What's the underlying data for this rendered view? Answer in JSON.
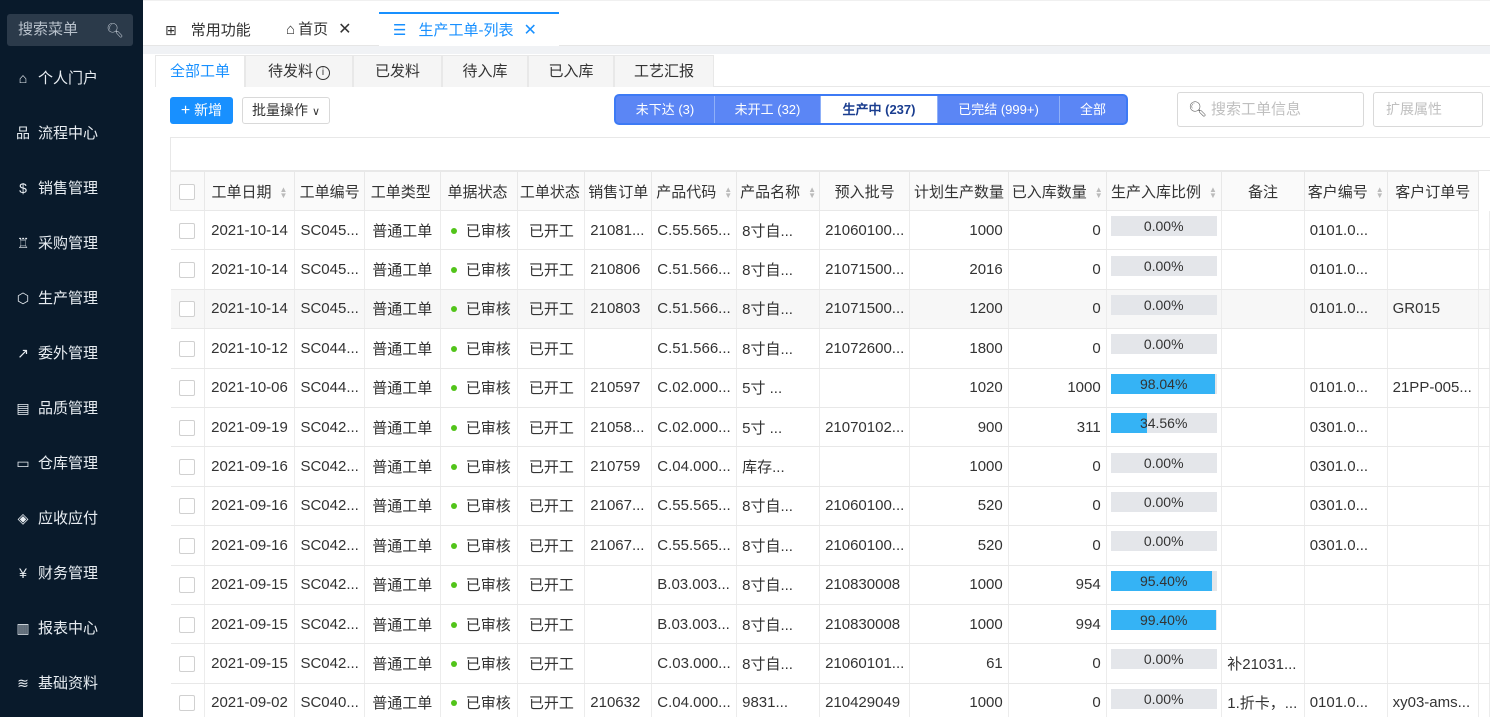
{
  "sidebar": {
    "search_placeholder": "搜索菜单",
    "items": [
      {
        "label": "个人门户",
        "icon": "home-icon",
        "glyph": "⌂"
      },
      {
        "label": "流程中心",
        "icon": "flow-icon",
        "glyph": "品"
      },
      {
        "label": "销售管理",
        "icon": "dollar-icon",
        "glyph": "$"
      },
      {
        "label": "采购管理",
        "icon": "cart-icon",
        "glyph": "♖"
      },
      {
        "label": "生产管理",
        "icon": "box-icon",
        "glyph": "⬡"
      },
      {
        "label": "委外管理",
        "icon": "external-link-icon",
        "glyph": "↗"
      },
      {
        "label": "品质管理",
        "icon": "quality-doc-icon",
        "glyph": "▤"
      },
      {
        "label": "仓库管理",
        "icon": "inbox-icon",
        "glyph": "▭"
      },
      {
        "label": "应收应付",
        "icon": "shield-icon",
        "glyph": "◈"
      },
      {
        "label": "财务管理",
        "icon": "yen-icon",
        "glyph": "¥"
      },
      {
        "label": "报表中心",
        "icon": "bar-chart-icon",
        "glyph": "▥"
      },
      {
        "label": "基础资料",
        "icon": "layers-icon",
        "glyph": "≋"
      }
    ]
  },
  "tabs": {
    "common": "常用功能",
    "home": "首页",
    "current": "生产工单-列表"
  },
  "subtabs": [
    "全部工单",
    "待发料",
    "已发料",
    "待入库",
    "已入库",
    "工艺汇报"
  ],
  "toolbar": {
    "add": "新增",
    "batch": "批量操作"
  },
  "segments": [
    "未下达 (3)",
    "未开工 (32)",
    "生产中 (237)",
    "已完结 (999+)",
    "全部"
  ],
  "search": {
    "placeholder": "搜索工单信息"
  },
  "ext_attr": "扩展属性",
  "table": {
    "columns": [
      "工单日期",
      "工单编号",
      "工单类型",
      "单据状态",
      "工单状态",
      "销售订单",
      "产品代码",
      "产品名称",
      "预入批号",
      "计划生产数量",
      "已入库数量",
      "生产入库比例",
      "备注",
      "客户编号",
      "客户订单号"
    ],
    "rows": [
      {
        "date": "2021-10-14",
        "no": "SC045...",
        "type": "普通工单",
        "doc": "已审核",
        "status": "已开工",
        "so": "21081...",
        "code": "C.55.565...",
        "name": "8寸自...",
        "batch": "21060100...",
        "plan": "1000",
        "in": "0",
        "ratio": 0.0,
        "ratio_text": "0.00%",
        "note": "",
        "cust": "0101.0...",
        "cust_order": ""
      },
      {
        "date": "2021-10-14",
        "no": "SC045...",
        "type": "普通工单",
        "doc": "已审核",
        "status": "已开工",
        "so": "210806",
        "code": "C.51.566...",
        "name": "8寸自...",
        "batch": "21071500...",
        "plan": "2016",
        "in": "0",
        "ratio": 0.0,
        "ratio_text": "0.00%",
        "note": "",
        "cust": "0101.0...",
        "cust_order": ""
      },
      {
        "date": "2021-10-14",
        "no": "SC045...",
        "type": "普通工单",
        "doc": "已审核",
        "status": "已开工",
        "so": "210803",
        "code": "C.51.566...",
        "name": "8寸自...",
        "batch": "21071500...",
        "plan": "1200",
        "in": "0",
        "ratio": 0.0,
        "ratio_text": "0.00%",
        "note": "",
        "cust": "0101.0...",
        "cust_order": "GR015"
      },
      {
        "date": "2021-10-12",
        "no": "SC044...",
        "type": "普通工单",
        "doc": "已审核",
        "status": "已开工",
        "so": "",
        "code": "C.51.566...",
        "name": "8寸自...",
        "batch": "21072600...",
        "plan": "1800",
        "in": "0",
        "ratio": 0.0,
        "ratio_text": "0.00%",
        "note": "",
        "cust": "",
        "cust_order": ""
      },
      {
        "date": "2021-10-06",
        "no": "SC044...",
        "type": "普通工单",
        "doc": "已审核",
        "status": "已开工",
        "so": "210597",
        "code": "C.02.000...",
        "name": "5寸 ...",
        "batch": "",
        "plan": "1020",
        "in": "1000",
        "ratio": 98.04,
        "ratio_text": "98.04%",
        "note": "",
        "cust": "0101.0...",
        "cust_order": "21PP-005..."
      },
      {
        "date": "2021-09-19",
        "no": "SC042...",
        "type": "普通工单",
        "doc": "已审核",
        "status": "已开工",
        "so": "21058...",
        "code": "C.02.000...",
        "name": "5寸 ...",
        "batch": "21070102...",
        "plan": "900",
        "in": "311",
        "ratio": 34.56,
        "ratio_text": "34.56%",
        "note": "",
        "cust": "0301.0...",
        "cust_order": ""
      },
      {
        "date": "2021-09-16",
        "no": "SC042...",
        "type": "普通工单",
        "doc": "已审核",
        "status": "已开工",
        "so": "210759",
        "code": "C.04.000...",
        "name": "库存...",
        "batch": "",
        "plan": "1000",
        "in": "0",
        "ratio": 0.0,
        "ratio_text": "0.00%",
        "note": "",
        "cust": "0301.0...",
        "cust_order": ""
      },
      {
        "date": "2021-09-16",
        "no": "SC042...",
        "type": "普通工单",
        "doc": "已审核",
        "status": "已开工",
        "so": "21067...",
        "code": "C.55.565...",
        "name": "8寸自...",
        "batch": "21060100...",
        "plan": "520",
        "in": "0",
        "ratio": 0.0,
        "ratio_text": "0.00%",
        "note": "",
        "cust": "0301.0...",
        "cust_order": ""
      },
      {
        "date": "2021-09-16",
        "no": "SC042...",
        "type": "普通工单",
        "doc": "已审核",
        "status": "已开工",
        "so": "21067...",
        "code": "C.55.565...",
        "name": "8寸自...",
        "batch": "21060100...",
        "plan": "520",
        "in": "0",
        "ratio": 0.0,
        "ratio_text": "0.00%",
        "note": "",
        "cust": "0301.0...",
        "cust_order": ""
      },
      {
        "date": "2021-09-15",
        "no": "SC042...",
        "type": "普通工单",
        "doc": "已审核",
        "status": "已开工",
        "so": "",
        "code": "B.03.003...",
        "name": "8寸自...",
        "batch": "210830008",
        "plan": "1000",
        "in": "954",
        "ratio": 95.4,
        "ratio_text": "95.40%",
        "note": "",
        "cust": "",
        "cust_order": ""
      },
      {
        "date": "2021-09-15",
        "no": "SC042...",
        "type": "普通工单",
        "doc": "已审核",
        "status": "已开工",
        "so": "",
        "code": "B.03.003...",
        "name": "8寸自...",
        "batch": "210830008",
        "plan": "1000",
        "in": "994",
        "ratio": 99.4,
        "ratio_text": "99.40%",
        "note": "",
        "cust": "",
        "cust_order": ""
      },
      {
        "date": "2021-09-15",
        "no": "SC042...",
        "type": "普通工单",
        "doc": "已审核",
        "status": "已开工",
        "so": "",
        "code": "C.03.000...",
        "name": "8寸自...",
        "batch": "21060101...",
        "plan": "61",
        "in": "0",
        "ratio": 0.0,
        "ratio_text": "0.00%",
        "note": "补21031...",
        "cust": "",
        "cust_order": ""
      },
      {
        "date": "2021-09-02",
        "no": "SC040...",
        "type": "普通工单",
        "doc": "已审核",
        "status": "已开工",
        "so": "210632",
        "code": "C.04.000...",
        "name": "9831...",
        "batch": "210429049",
        "plan": "1000",
        "in": "0",
        "ratio": 0.0,
        "ratio_text": "0.00%",
        "note": "1.折卡，...",
        "cust": "0101.0...",
        "cust_order": "xy03-ams..."
      }
    ]
  }
}
